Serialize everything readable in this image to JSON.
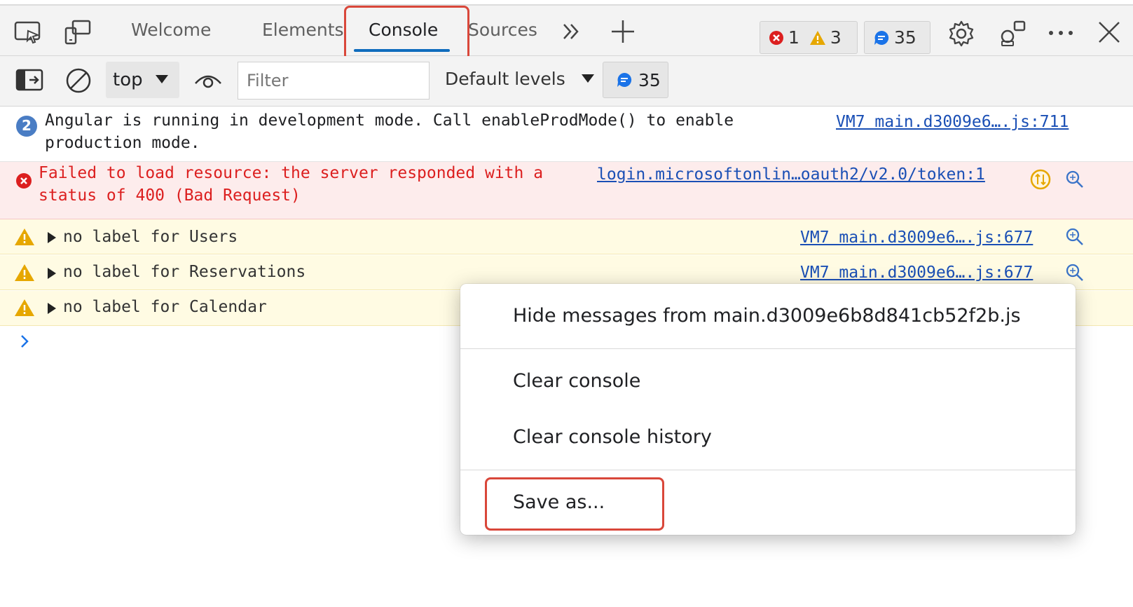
{
  "tabs": {
    "welcome": "Welcome",
    "elements": "Elements",
    "console": "Console",
    "sources": "Sources"
  },
  "counters": {
    "errors": "1",
    "warnings": "3",
    "messages": "35"
  },
  "toolbar": {
    "context": "top",
    "filter_placeholder": "Filter",
    "levels": "Default levels",
    "issues": "35"
  },
  "messages": {
    "info": {
      "repeat_count": "2",
      "line1": "Angular is running in development mode. Call enableProdMode() to enable",
      "line2": "production mode.",
      "source": "VM7 main.d3009e6….js:711"
    },
    "error": {
      "line1": "Failed to load resource: the server responded with a",
      "line2": "status of 400 (Bad Request)",
      "source": "login.microsoftonlin…oauth2/v2.0/token:1"
    },
    "warnings": [
      {
        "text": "no label for Users",
        "source": "VM7 main.d3009e6….js:677"
      },
      {
        "text": "no label for Reservations",
        "source": "VM7 main.d3009e6….js:677"
      },
      {
        "text": "no label for Calendar",
        "source": ""
      }
    ]
  },
  "context_menu": {
    "hide_messages": "Hide messages from main.d3009e6b8d841cb52f2b.js",
    "clear_console": "Clear console",
    "clear_history": "Clear console history",
    "save_as": "Save as..."
  },
  "colors": {
    "accent": "#0f6cbd",
    "highlight": "#d9473a",
    "error_text": "#dc1f1f",
    "error_bg": "#fdecec",
    "warning_bg": "#fffbe3",
    "link": "#1a4fb5"
  }
}
